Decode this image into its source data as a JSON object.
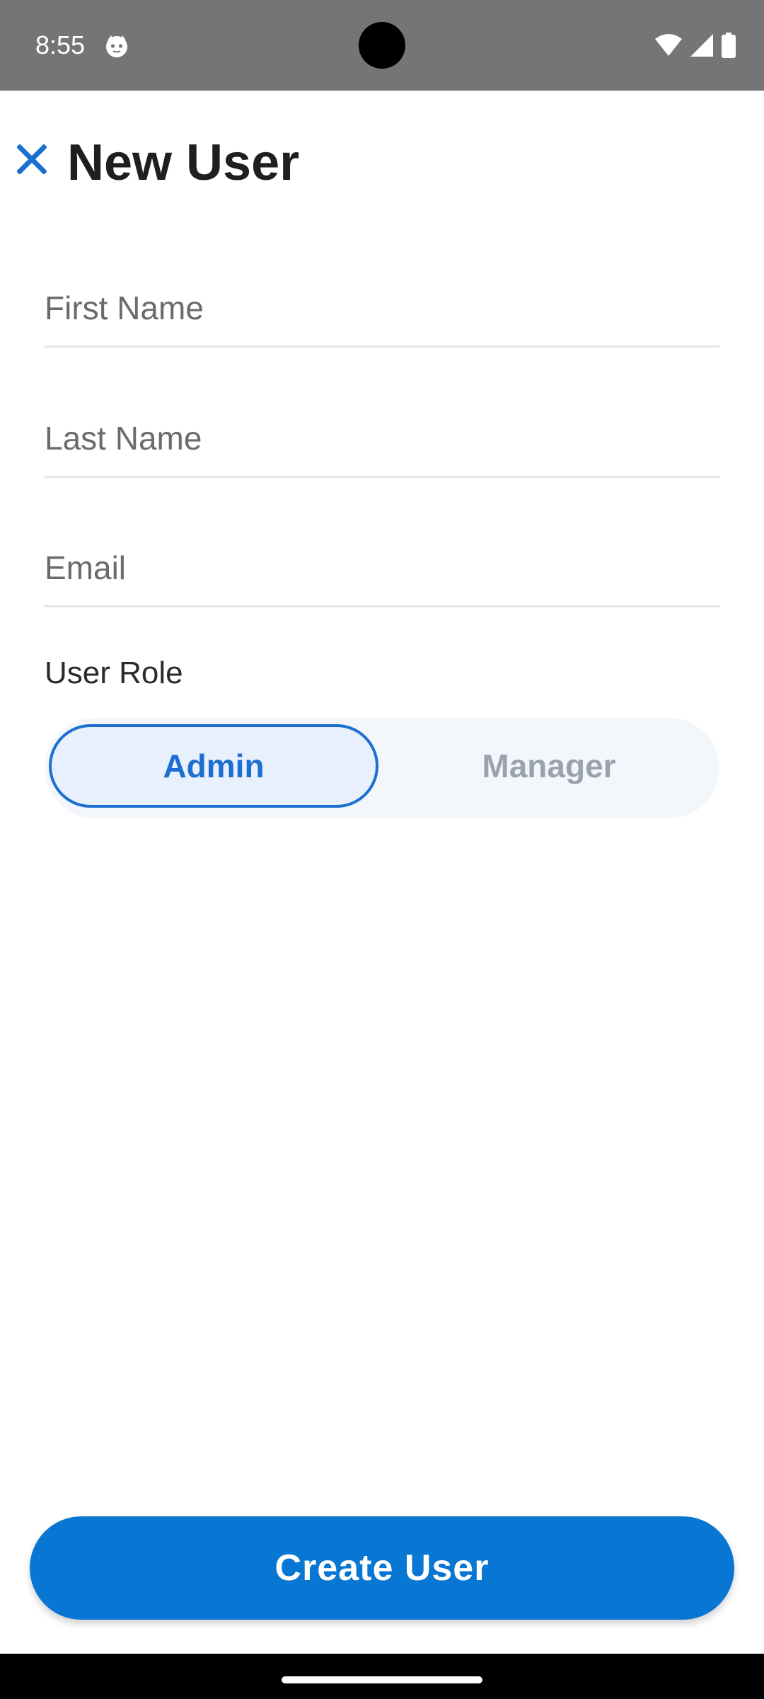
{
  "status_bar": {
    "time": "8:55",
    "app_icon": "cat-face-icon",
    "icons": [
      "wifi-icon",
      "signal-icon",
      "battery-icon"
    ],
    "background_color": "#757575"
  },
  "app_bar": {
    "title": "New User",
    "close_icon": "close-icon",
    "accent_color": "#1c6fd0"
  },
  "form": {
    "first_name": {
      "value": "",
      "placeholder": "First Name"
    },
    "last_name": {
      "value": "",
      "placeholder": "Last Name"
    },
    "email": {
      "value": "",
      "placeholder": "Email"
    }
  },
  "user_role": {
    "label": "User Role",
    "options": [
      "Admin",
      "Manager"
    ],
    "selected": "Admin"
  },
  "actions": {
    "create_label": "Create User",
    "create_color": "#0877d3"
  }
}
